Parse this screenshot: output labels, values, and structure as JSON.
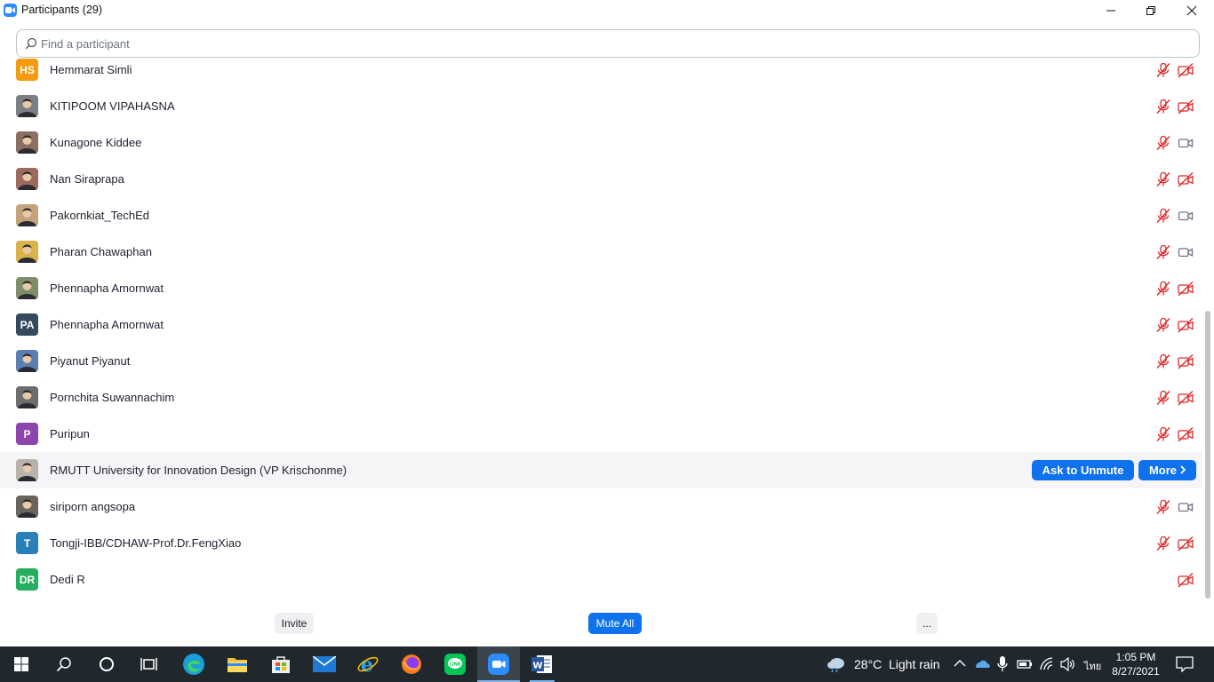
{
  "window": {
    "title": "Participants (29)"
  },
  "search": {
    "placeholder": "Find a participant",
    "value": ""
  },
  "participants": [
    {
      "name": "Hemmarat Simli",
      "initials": "HS",
      "avatar_color": "#f39c12",
      "mic": "muted",
      "video": "off"
    },
    {
      "name": "KITIPOOM VIPAHASNA",
      "initials": "",
      "avatar_color": "#7a7f86",
      "mic": "muted",
      "video": "off"
    },
    {
      "name": "Kunagone Kiddee",
      "initials": "",
      "avatar_color": "#8a6f62",
      "mic": "muted",
      "video": "on"
    },
    {
      "name": "Nan Siraprapa",
      "initials": "",
      "avatar_color": "#9c6b5f",
      "mic": "muted",
      "video": "off"
    },
    {
      "name": "Pakornkiat_TechEd",
      "initials": "",
      "avatar_color": "#c5a27a",
      "mic": "muted",
      "video": "on"
    },
    {
      "name": "Pharan Chawaphan",
      "initials": "",
      "avatar_color": "#d9b24a",
      "mic": "muted",
      "video": "on"
    },
    {
      "name": "Phennapha Amornwat",
      "initials": "",
      "avatar_color": "#7c8f6a",
      "mic": "muted",
      "video": "off"
    },
    {
      "name": "Phennapha Amornwat",
      "initials": "PA",
      "avatar_color": "#34495e",
      "mic": "muted",
      "video": "off"
    },
    {
      "name": "Piyanut Piyanut",
      "initials": "",
      "avatar_color": "#5b7fb0",
      "mic": "muted",
      "video": "off"
    },
    {
      "name": "Pornchita Suwannachim",
      "initials": "",
      "avatar_color": "#6d6d6d",
      "mic": "muted",
      "video": "off"
    },
    {
      "name": "Puripun",
      "initials": "P",
      "avatar_color": "#8e44ad",
      "mic": "muted",
      "video": "off"
    },
    {
      "name": "RMUTT University for Innovation Design (VP Krischonme)",
      "initials": "",
      "avatar_color": "#b7b2aa",
      "mic": "none",
      "video": "none",
      "hovered": true
    },
    {
      "name": "siriporn angsopa",
      "initials": "",
      "avatar_color": "#6a6460",
      "mic": "muted",
      "video": "on"
    },
    {
      "name": "Tongji-IBB/CDHAW-Prof.Dr.FengXiao",
      "initials": "T",
      "avatar_color": "#2980b9",
      "mic": "muted",
      "video": "off"
    },
    {
      "name": "Dedi R",
      "initials": "DR",
      "avatar_color": "#27ae60",
      "mic": "none",
      "video": "off"
    }
  ],
  "row_actions": {
    "ask_to_unmute": "Ask to Unmute",
    "more": "More"
  },
  "footer": {
    "invite": "Invite",
    "mute_all": "Mute All",
    "more": "..."
  },
  "taskbar": {
    "weather_temp": "28°C",
    "weather_text": "Light rain",
    "lang": "ไทย",
    "time": "1:05 PM",
    "date": "8/27/2021"
  },
  "colors": {
    "zoom_blue": "#0e72ed",
    "muted_red": "#e02828",
    "taskbar": "#20282e"
  }
}
